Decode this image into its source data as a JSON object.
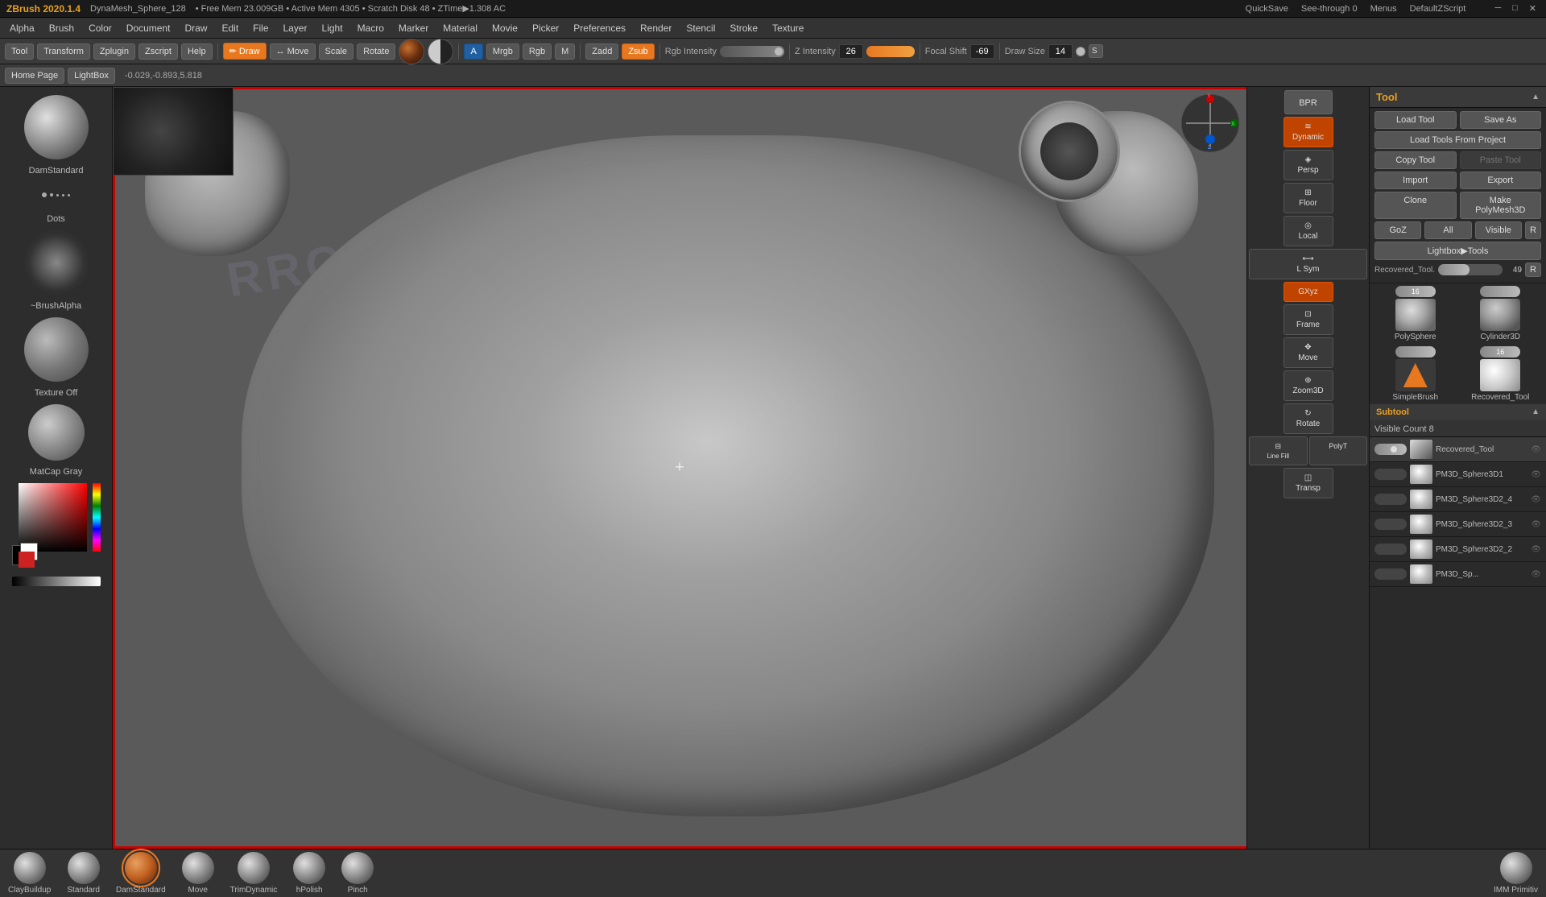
{
  "titlebar": {
    "app": "ZBrush 2020.1.4",
    "mesh": "DynaMesh_Sphere_128",
    "bullets": "• Free Mem 23.009GB • Active Mem 4305 • Scratch Disk 48 • ZTime▶1.308 AC",
    "quicksave": "QuickSave",
    "seethrough": "See-through 0",
    "menus": "Menus",
    "default_zscript": "DefaultZScript",
    "close": "✕",
    "maximize": "□",
    "minimize": "─"
  },
  "menubar": {
    "items": [
      "Alpha",
      "Brush",
      "Color",
      "Document",
      "Draw",
      "Edit",
      "File",
      "Layer",
      "Light",
      "Macro",
      "Marker",
      "Material",
      "Movie",
      "Picker",
      "Preferences",
      "Render",
      "Stencil",
      "Stroke",
      "Texture"
    ]
  },
  "toolbar": {
    "tool_label": "Tool",
    "transform_label": "Transform",
    "zplugin_label": "Zplugin",
    "zscript_label": "Zscript",
    "help_label": "Help",
    "draw_btn": "Draw",
    "move_btn": "Move",
    "scale_btn": "Scale",
    "rotate_btn": "Rotate",
    "a_btn": "A",
    "mrgb_btn": "Mrgb",
    "rgb_btn": "Rgb",
    "m_btn": "M",
    "zadd_btn": "Zadd",
    "zsub_btn": "Zsub",
    "rgb_intensity_label": "Rgb Intensity",
    "rgb_intensity_val": "",
    "focal_shift_label": "Focal Shift",
    "focal_shift_val": "-69",
    "draw_size_label": "Draw Size",
    "draw_size_val": "14",
    "z_intensity_label": "Z Intensity",
    "z_intensity_val": "26",
    "coords": "-0.029,-0.893,5.818"
  },
  "left_panel": {
    "home_page": "Home Page",
    "lightbox": "LightBox",
    "brush_name": "DamStandard",
    "dots_label": "Dots",
    "alpha_label": "~BrushAlpha",
    "texture_label": "Texture Off",
    "matcap_label": "MatCap Gray"
  },
  "right_panel": {
    "title": "Tool",
    "load_tool": "Load Tool",
    "save_as": "Save As",
    "load_from_project": "Load Tools From Project",
    "copy_tool": "Copy Tool",
    "paste_tool": "Paste Tool",
    "import": "Import",
    "export": "Export",
    "clone": "Clone",
    "make_polymesh3d": "Make PolyMesh3D",
    "goz": "GoZ",
    "all": "All",
    "visible": "Visible",
    "r_label": "R",
    "lightbox_tools": "Lightbox▶Tools",
    "recovered_tool_label": "Recovered_Tool.",
    "recovered_tool_val": "49",
    "r2_label": "R",
    "bpr_label": "BPR",
    "polymesh_label": "PolySphere",
    "cylinder_label": "Cylinder3D",
    "recovered_tool2": "Recovered_Tool",
    "cylinder3d": "Cylinder3D",
    "simplebrush": "SimpleBrush",
    "recovered_tool3": "Recovered_Tool",
    "num16_1": "16",
    "num16_2": "16",
    "subtool_title": "Subtool",
    "visible_count": "Visible Count 8",
    "subtool_items": [
      {
        "name": "Recovered_Tool",
        "active": true
      },
      {
        "name": "PM3D_Sphere3D1",
        "active": false
      },
      {
        "name": "PM3D_Sphere3D2_4",
        "active": false
      },
      {
        "name": "PM3D_Sphere3D2_3",
        "active": false
      },
      {
        "name": "PM3D_Sphere3D2_2",
        "active": false
      },
      {
        "name": "PM3D_Sp...",
        "active": false
      }
    ]
  },
  "side_controls": {
    "dynamic_label": "Dynamic",
    "persp_label": "Persp",
    "floor_label": "Floor",
    "local_label": "Local",
    "l_sym_label": "L Sym",
    "gxyz_label": "GXyz",
    "frame_label": "Frame",
    "move_label": "Move",
    "zoom3d_label": "Zoom3D",
    "rotate_label": "Rotate",
    "line_fill_label": "Line Fill",
    "polyt_label": "PolyT",
    "transp_label": "Transp"
  },
  "bottom_brushes": {
    "items": [
      "ClayBuildup",
      "Standard",
      "DamStandard",
      "Move",
      "TrimDynamic",
      "hPolish",
      "Pinch",
      "IMM Primitiv"
    ]
  }
}
